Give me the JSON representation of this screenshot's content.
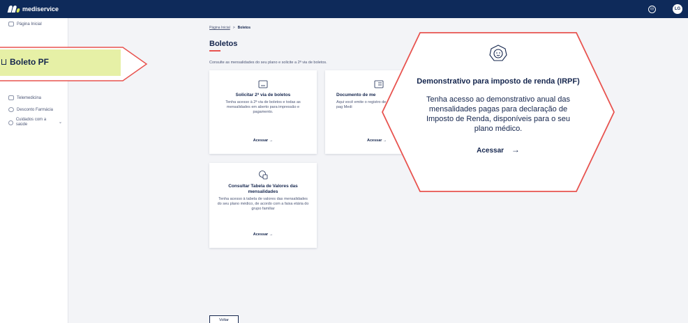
{
  "header": {
    "brand": "mediservice",
    "avatar_initials": "LG",
    "accessibility_icon": "accessibility-icon"
  },
  "sidebar": {
    "items": [
      {
        "label": "Página Inicial",
        "icon": "home-grid-icon"
      },
      {
        "label": "Telemedicina",
        "icon": "video-icon"
      },
      {
        "label": "Desconto Farmácia",
        "icon": "pharmacy-icon"
      },
      {
        "label": "Cuidados com a saúde",
        "icon": "health-icon"
      }
    ],
    "highlight_label": "Boleto PF"
  },
  "breadcrumb": {
    "home": "Página Inicial",
    "separator": ">",
    "current": "Boletos"
  },
  "page": {
    "title": "Boletos",
    "subtitle": "Consulte as mensalidades do seu plano e solicite a 2ª via de boletos."
  },
  "cards": [
    {
      "title": "Solicitar 2ª via de boletos",
      "description": "Tenha acesso à 2ª via de boletos e todas as mensalidades em aberto para impressão e pagamento.",
      "action": "Acessar →"
    },
    {
      "title": "Documento de me",
      "description": "Aqui você emite o registro de pag Medi",
      "action": "Acessar →"
    },
    {
      "title": "Consultar Tabela de Valores das mensalidades",
      "description": "Tenha acesso à tabela de valores das mensalidades do seu plano médico, de acordo com a faixa etária do grupo familiar",
      "action": "Acessar →"
    }
  ],
  "callout": {
    "title": "Demonstrativo para imposto de renda (IRPF)",
    "description": "Tenha acesso ao demonstrativo anual das mensalidades pagas para declaração de Imposto de Renda, disponíveis para o seu plano médico.",
    "action": "Acessar",
    "arrow": "→",
    "accent_color": "#e8534f"
  },
  "footer": {
    "back_label": "Voltar"
  },
  "colors": {
    "header_bg": "#0e2a5a",
    "highlight_bg": "#e6f0a6",
    "accent": "#e8534f",
    "text": "#14254d"
  }
}
